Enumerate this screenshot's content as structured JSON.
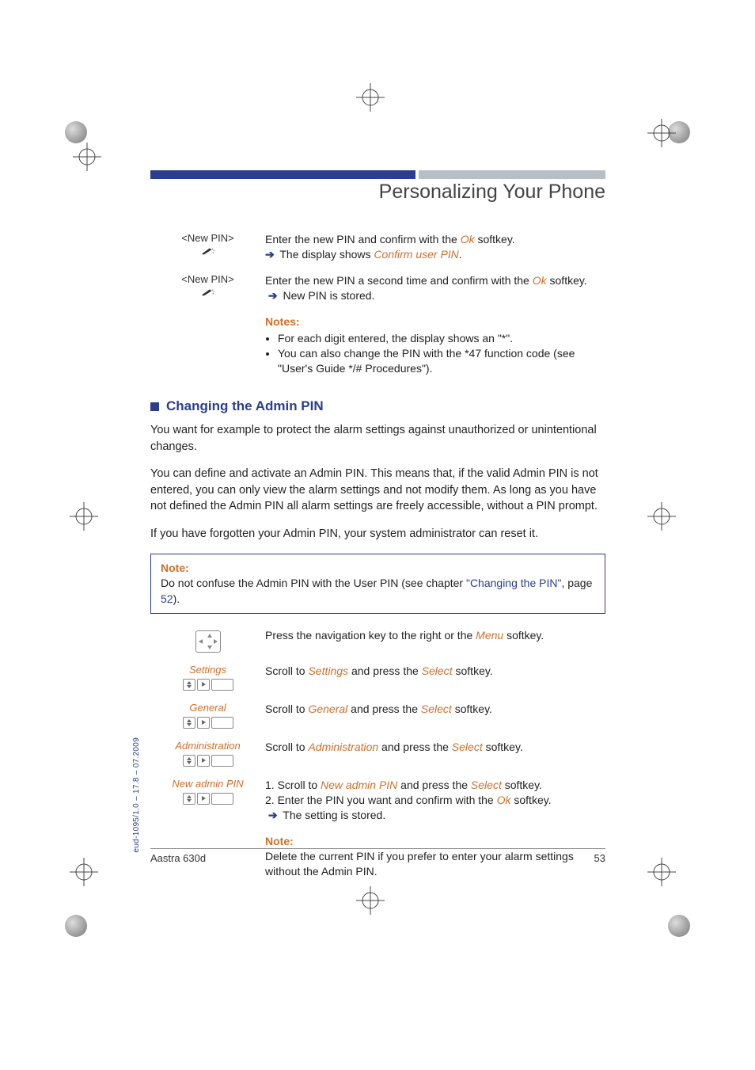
{
  "header": {
    "title": "Personalizing Your Phone"
  },
  "pin_steps": {
    "step1": {
      "label": "<New PIN>",
      "text_a": "Enter the new PIN and confirm with the ",
      "ok": "Ok",
      "text_b": " softkey.",
      "result_a": " The display shows ",
      "result_em": "Confirm user PIN",
      "result_b": "."
    },
    "step2": {
      "label": "<New PIN>",
      "text_a": "Enter the new PIN a second time and confirm with the ",
      "ok": "Ok",
      "text_b": " softkey.",
      "result": " New PIN is stored."
    }
  },
  "notes_block": {
    "head": "Notes:",
    "li1": "For each digit entered, the display shows an \"*\".",
    "li2": "You can also change the PIN with the *47 function code (see \"User's Guide */# Procedures\")."
  },
  "section": {
    "title": "Changing the Admin PIN",
    "p1": "You want for example to protect the alarm settings against unauthorized or unintentional changes.",
    "p2": "You can define and activate an Admin PIN. This means that, if the valid Admin PIN is not entered, you can only view the alarm settings and not modify them. As long as you have not defined the Admin PIN all alarm settings are freely accessible, without a PIN prompt.",
    "p3": "If you have forgotten your Admin PIN, your system administrator can reset it."
  },
  "note_box": {
    "head": "Note:",
    "text_a": "Do not confuse the Admin PIN with the User PIN (see chapter ",
    "link": "\"Changing the PIN\"",
    "text_b": ", page ",
    "page": "52",
    "text_c": ")."
  },
  "proc": {
    "nav": {
      "text_a": "Press the navigation key to the right or the ",
      "menu": "Menu",
      "text_b": " softkey."
    },
    "settings": {
      "label": "Settings",
      "text_a": "Scroll to ",
      "em": "Settings",
      "text_b": " and press the ",
      "select": "Select",
      "text_c": " softkey."
    },
    "general": {
      "label": "General",
      "text_a": "Scroll to ",
      "em": "General",
      "text_b": " and press the ",
      "select": "Select",
      "text_c": " softkey."
    },
    "admin": {
      "label": "Administration",
      "text_a": "Scroll to ",
      "em": "Administration",
      "text_b": " and press the ",
      "select": "Select",
      "text_c": " softkey."
    },
    "newpin": {
      "label": "New admin PIN",
      "li1_a": "1. Scroll to ",
      "li1_em": "New admin PIN",
      "li1_b": " and press the ",
      "li1_sel": "Select",
      "li1_c": " softkey.",
      "li2_a": "2. Enter the PIN you want and confirm with the ",
      "li2_ok": "Ok",
      "li2_b": " softkey.",
      "result": " The setting is stored."
    }
  },
  "note2": {
    "head": "Note:",
    "text": "Delete the current PIN if you prefer to enter your alarm settings without the Admin PIN."
  },
  "footer": {
    "left": "Aastra 630d",
    "right": "53"
  },
  "side": "eud-1095/1.0 – 17.8 – 07.2009"
}
